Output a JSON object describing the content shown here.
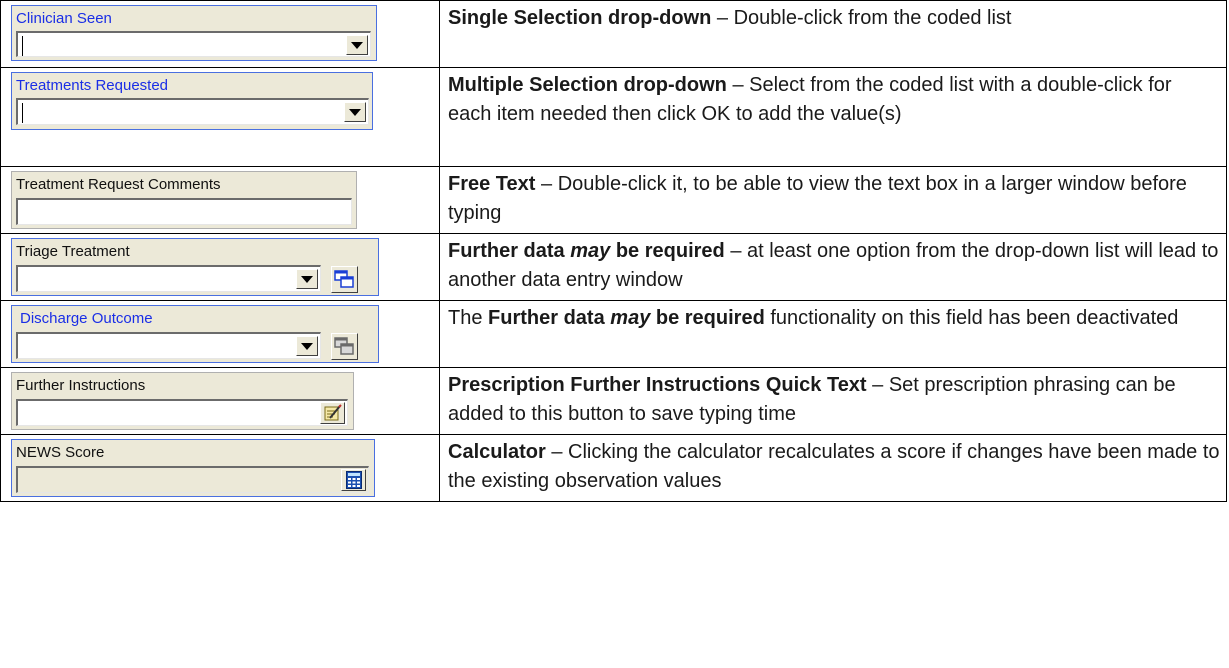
{
  "rows": [
    {
      "widget_label": "Clinician Seen",
      "bold": "Single Selection drop-down",
      "text": " – Double-click from the coded list"
    },
    {
      "widget_label": "Treatments Requested",
      "bold": "Multiple Selection drop-down",
      "text": " – Select from the coded list with a double-click for each item needed then click OK to add the value(s)"
    },
    {
      "widget_label": "Treatment Request Comments",
      "bold": "Free Text",
      "text": " – Double-click it, to be able to view the text box in a larger window before typing"
    },
    {
      "widget_label": "Triage Treatment",
      "bold_a": "Further data ",
      "bold_italic": "may",
      "bold_b": " be required",
      "text": " – at least one option from the drop-down list will lead to another data entry window"
    },
    {
      "widget_label": "Discharge Outcome",
      "pre": "The ",
      "bold_a": "Further data ",
      "bold_italic": "may",
      "bold_b": " be required",
      "text": " functionality on this field has been deactivated"
    },
    {
      "widget_label": "Further Instructions",
      "bold": "Prescription Further Instructions Quick Text",
      "text": " – Set prescription phrasing can be added to this button to save typing time"
    },
    {
      "widget_label": "NEWS Score",
      "bold": "Calculator",
      "text": " – Clicking the calculator recalculates a score if changes have been made to the existing observation values"
    }
  ],
  "icons": {
    "dropdown": "chevron-down-icon",
    "further_data_active": "windows-stack-icon",
    "further_data_inactive": "windows-stack-disabled-icon",
    "quick_text": "pen-notepad-icon",
    "calculator": "calculator-icon"
  },
  "colors": {
    "blue_border": "#4a6fe0",
    "blue_label": "#1a2ee6",
    "widget_bg": "#ece9d8"
  }
}
